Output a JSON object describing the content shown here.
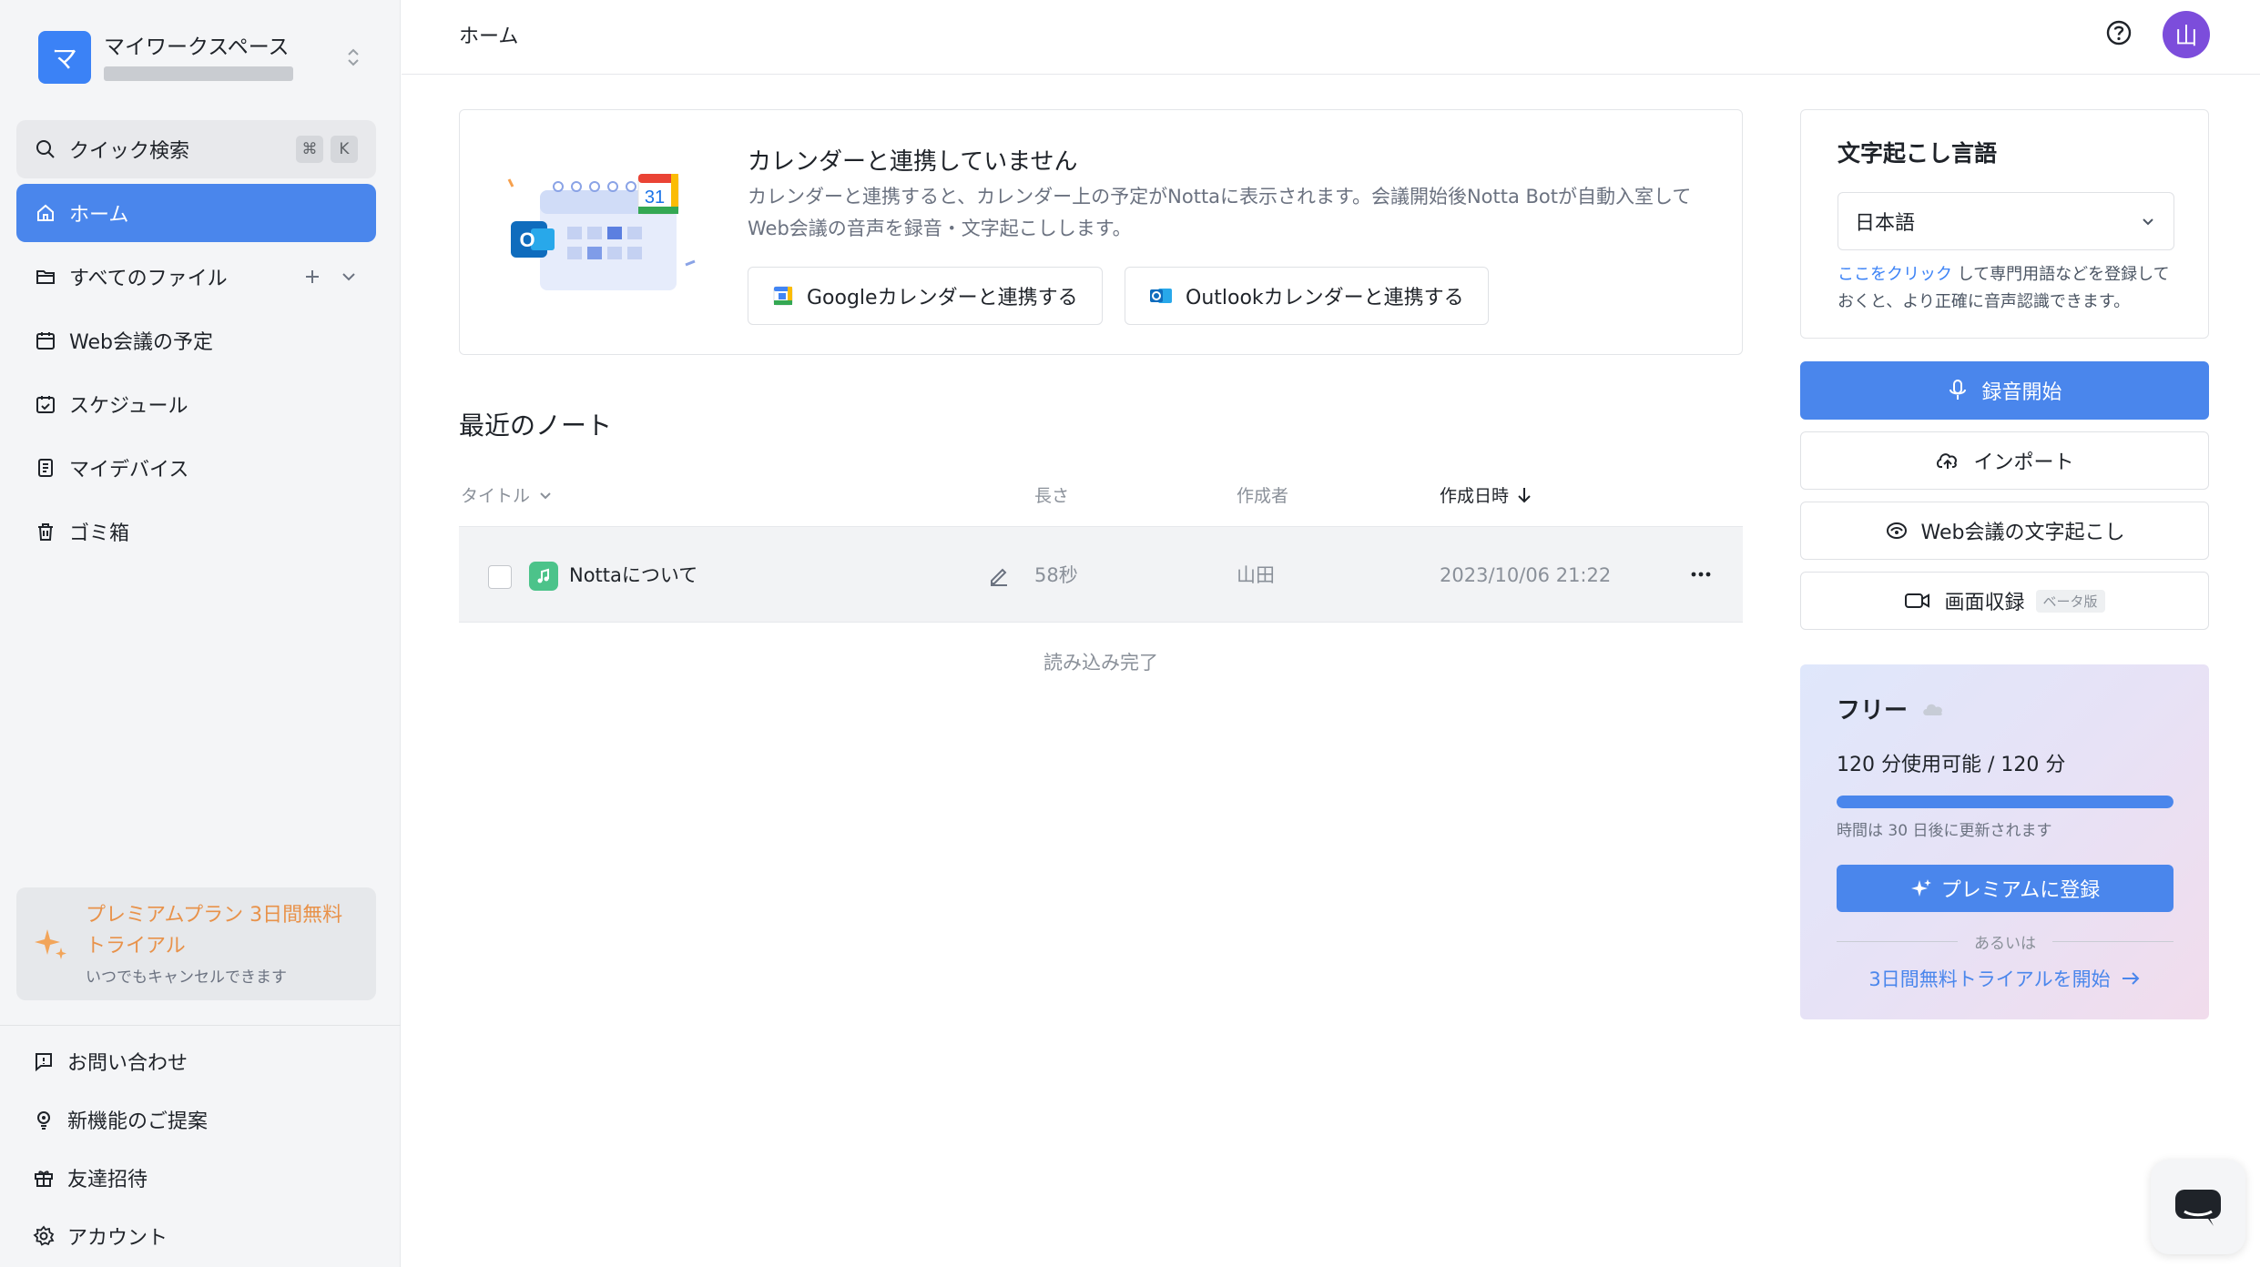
{
  "workspace": {
    "avatar_letter": "マ",
    "name": "マイワークスペース"
  },
  "search": {
    "label": "クイック検索",
    "key1": "⌘",
    "key2": "K"
  },
  "nav": {
    "home": "ホーム",
    "all_files": "すべてのファイル",
    "web_meetings": "Web会議の予定",
    "schedule": "スケジュール",
    "my_devices": "マイデバイス",
    "trash": "ゴミ箱"
  },
  "promo": {
    "title": "プレミアムプラン 3日間無料トライアル",
    "subtitle": "いつでもキャンセルできます"
  },
  "footer": {
    "contact": "お問い合わせ",
    "feature_request": "新機能のご提案",
    "invite": "友達招待",
    "account": "アカウント"
  },
  "topbar": {
    "breadcrumb": "ホーム",
    "user_initial": "山"
  },
  "calendar": {
    "title": "カレンダーと連携していません",
    "description": "カレンダーと連携すると、カレンダー上の予定がNottaに表示されます。会議開始後Notta Botが自動入室してWeb会議の音声を録音・文字起こしします。",
    "google_button": "Googleカレンダーと連携する",
    "outlook_button": "Outlookカレンダーと連携する",
    "calendar_day": "31",
    "outlook_letter": "O"
  },
  "notes": {
    "title": "最近のノート",
    "columns": {
      "title": "タイトル",
      "length": "長さ",
      "author": "作成者",
      "created": "作成日時"
    },
    "rows": [
      {
        "title": "Nottaについて",
        "length": "58秒",
        "author": "山田",
        "created": "2023/10/06 21:22"
      }
    ],
    "loaded_text": "読み込み完了"
  },
  "language": {
    "title": "文字起こし言語",
    "selected": "日本語",
    "hint_link": "ここをクリック",
    "hint_text": " して専門用語などを登録しておくと、より正確に音声認識できます。"
  },
  "actions": {
    "record": "録音開始",
    "import": "インポート",
    "web_transcribe": "Web会議の文字起こし",
    "screen_record": "画面収録",
    "beta": "ベータ版"
  },
  "plan": {
    "name": "フリー",
    "usage": "120 分使用可能 / 120 分",
    "usage_fraction": 1.0,
    "reset": "時間は 30 日後に更新されます",
    "upgrade_button": "プレミアムに登録",
    "or": "あるいは",
    "trial_link": "3日間無料トライアルを開始"
  },
  "colors": {
    "accent": "#4a86ec",
    "promo": "#e8924a",
    "avatar": "#7c4ddb"
  }
}
